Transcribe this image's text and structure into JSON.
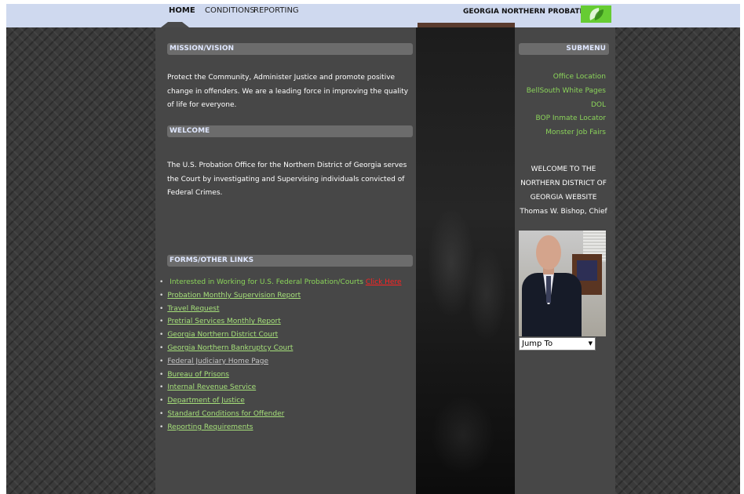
{
  "nav": {
    "items": [
      "HOME",
      "CONDITIONS",
      "REPORTING"
    ],
    "brand": "GEORGIA NORTHERN PROBATION"
  },
  "main": {
    "mission_heading": "MISSION/VISION",
    "mission_text": "Protect the Community, Administer Justice and promote positive change in offenders. We are a leading force in improving the quality of life for everyone.",
    "welcome_heading": "WELCOME",
    "welcome_text": "The U.S. Probation Office for the Northern District of Georgia serves the Court by investigating and Supervising individuals convicted of Federal Crimes.",
    "forms_heading": "FORMS/OTHER LINKS",
    "links": {
      "interested": "Interested in Working for U.S. Federal Probation/Courts",
      "click_here": "Click Here",
      "items": [
        "Probation Monthly Supervision Report",
        "Travel Request",
        "Pretrial Services Monthly Report",
        "Georgia Northern District Court",
        "Georgia Northern Bankruptcy Court",
        "Federal Judiciary Home Page",
        "Bureau of Prisons",
        "Internal Revenue Service",
        "Department of Justice",
        "Standard Conditions for Offender",
        "Reporting Requirements"
      ]
    }
  },
  "sidebar": {
    "submenu_heading": "SUBMENU",
    "submenu_items": [
      "Office Location",
      "BellSouth White Pages",
      "DOL",
      "BOP Inmate Locator",
      "Monster Job Fairs"
    ],
    "welcome_lines": [
      "WELCOME TO THE",
      "NORTHERN DISTRICT OF",
      "GEORGIA WEBSITE",
      "Thomas W. Bishop, Chief"
    ],
    "jump_to": "Jump To",
    "jump_arrow": "▼"
  },
  "colors": {
    "link_green": "#8bd45a",
    "click_here_red": "#ff2222",
    "panel": "#474747",
    "nav_bar": "#cfd9ef",
    "logo_green": "#66cc33"
  },
  "icons": {
    "logo": "leaf-logo-icon",
    "bullet": "bullet-icon",
    "dropdown": "chevron-down-icon"
  }
}
